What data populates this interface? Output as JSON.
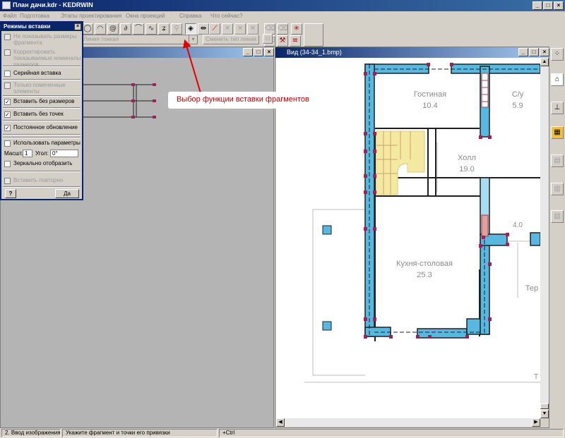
{
  "app": {
    "title": "План дачи.kdr - KEDRWIN",
    "window_buttons": [
      "_",
      "□",
      "×"
    ]
  },
  "menu": [
    "Файл",
    "Подготовка",
    "Этапы проектирования",
    "Окна проекций",
    "Справка",
    "Что сейчас?"
  ],
  "toolbar": {
    "line_type": "Линия тонкая",
    "change_line_type": "Сменить тип линии"
  },
  "panel": {
    "title": "Режимы вставки",
    "options": [
      {
        "label": "Не показывать размеры фрагмента",
        "checked": false,
        "enabled": false
      },
      {
        "label": "Корректировать показываемые номиналы размеров",
        "checked": false,
        "enabled": false
      },
      {
        "label": "Серийная вставка",
        "checked": false,
        "enabled": true
      },
      {
        "label": "Только помеченные элементы",
        "checked": false,
        "enabled": false
      },
      {
        "label": "Вставить без размеров",
        "checked": true,
        "enabled": true
      },
      {
        "label": "Вставить без точек",
        "checked": true,
        "enabled": true
      },
      {
        "label": "Постоянное обновление",
        "checked": true,
        "enabled": true
      }
    ],
    "use_params": "Использовать параметры",
    "scale_label": "Масшт.",
    "scale_value": "1",
    "angle_label": "Угол:",
    "angle_value": "0°",
    "mirror": "Зеркально отобразить",
    "repeat": "Вставить повторно",
    "help_button": "?",
    "ok_button": "Да"
  },
  "view_window": {
    "title": "Вид (34-34_1.bmp)"
  },
  "plan": {
    "rooms": [
      {
        "name": "Гостиная",
        "area": "10.4"
      },
      {
        "name": "С/у",
        "area": "5.9"
      },
      {
        "name": "Холл",
        "area": "19.0"
      },
      {
        "name": "Кухня-столовая",
        "area": "25.3"
      },
      {
        "name": "",
        "area": "4.0"
      },
      {
        "name": "Тер",
        "area": ""
      }
    ],
    "edge_label": "Т"
  },
  "annotation": {
    "text": "Выбор функции вставки фрагментов",
    "color": "#cc0000"
  },
  "status": {
    "mode": "2. Ввод изображения",
    "hint": "Укажите фрагмент и точки его привязки",
    "modifier": "+Ctrl"
  },
  "colors": {
    "title_active": "#0a246a",
    "wall_fill": "#58b8e0",
    "stair_fill": "#f3e9a0",
    "annotation": "#cc0000"
  }
}
